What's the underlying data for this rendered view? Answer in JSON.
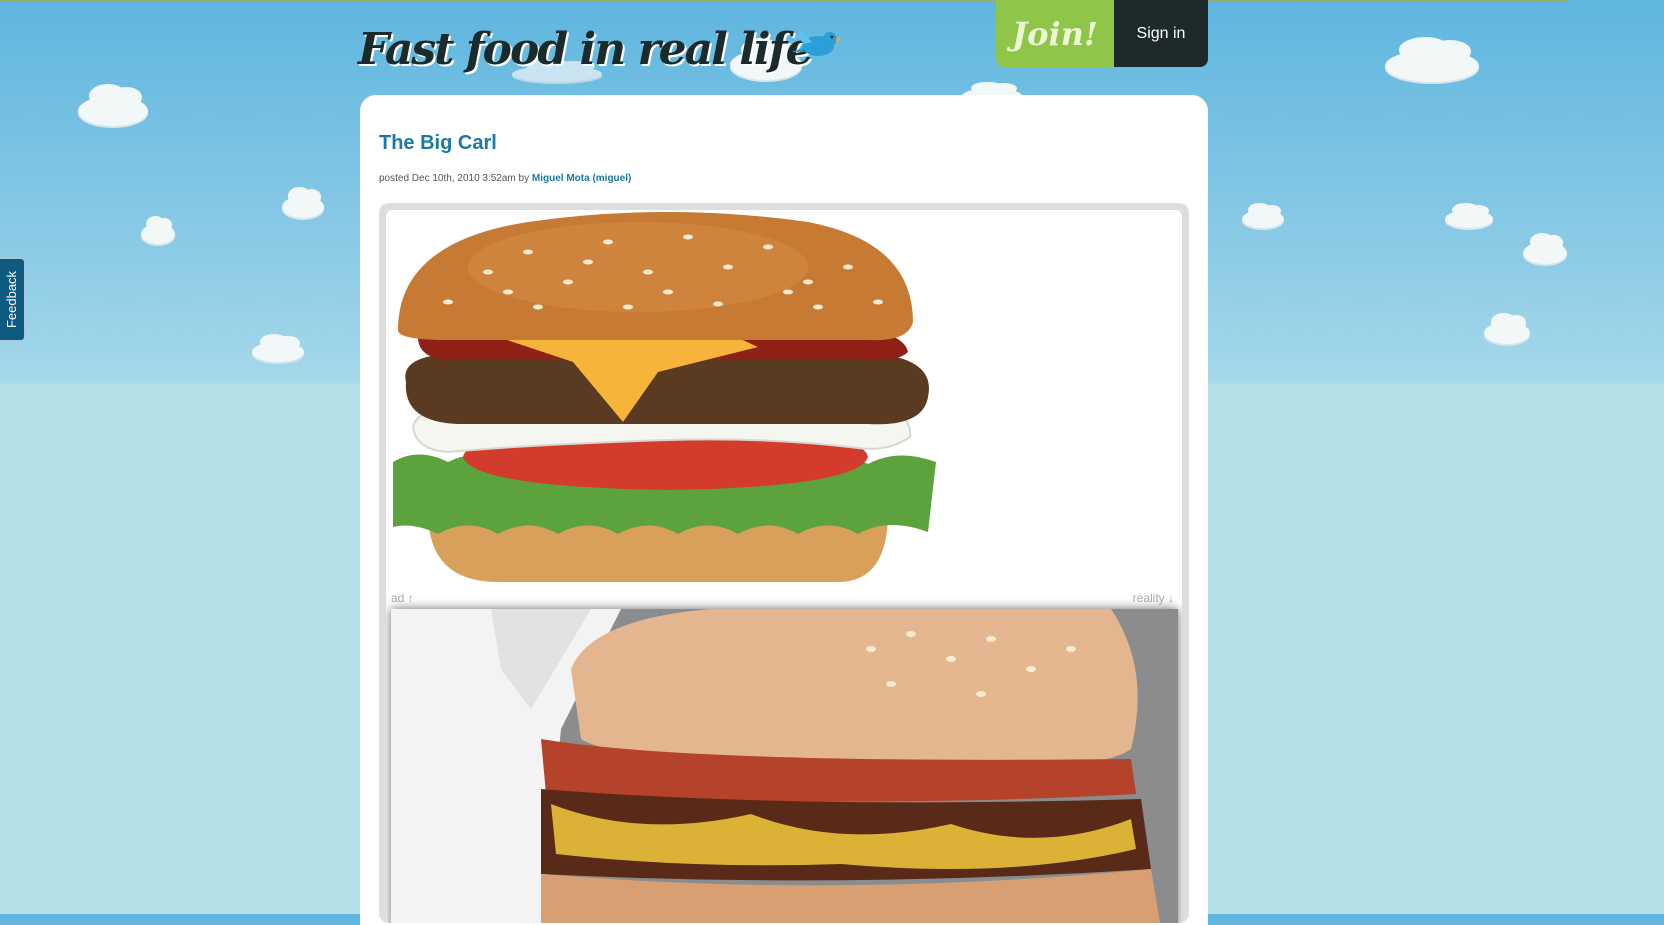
{
  "header": {
    "logo_text": "Fast food in real life",
    "join_label": "Join!",
    "signin_label": "Sign in"
  },
  "feedback_tab": {
    "label": "Feedback"
  },
  "post": {
    "title": "The Big Carl",
    "posted_prefix": "posted Dec 10th, 2010 3:52am by",
    "author": "Miguel Mota (miguel)",
    "ad_label": "ad ↑",
    "reality_label": "reality ↓"
  },
  "colors": {
    "sky": "#5fb6df",
    "join_bg": "#8fc549",
    "signin_bg": "#1e2a2a",
    "title_link": "#1a7aa3",
    "feedback_bg": "#0f5a80"
  }
}
